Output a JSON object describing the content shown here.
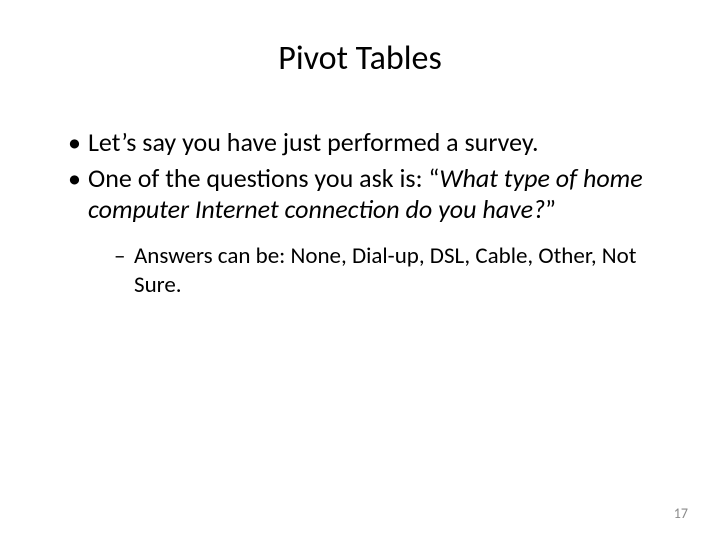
{
  "title": "Pivot Tables",
  "bullets": {
    "b1": "Let’s say you have just performed a survey.",
    "b2_prefix": "One of the questions you ask is: “",
    "b2_italic": "What type of home computer Internet connection do you have?",
    "b2_suffix": "”"
  },
  "sub": {
    "s1": "Answers can be:  None, Dial-up, DSL, Cable, Other, Not Sure."
  },
  "page_number": "17"
}
